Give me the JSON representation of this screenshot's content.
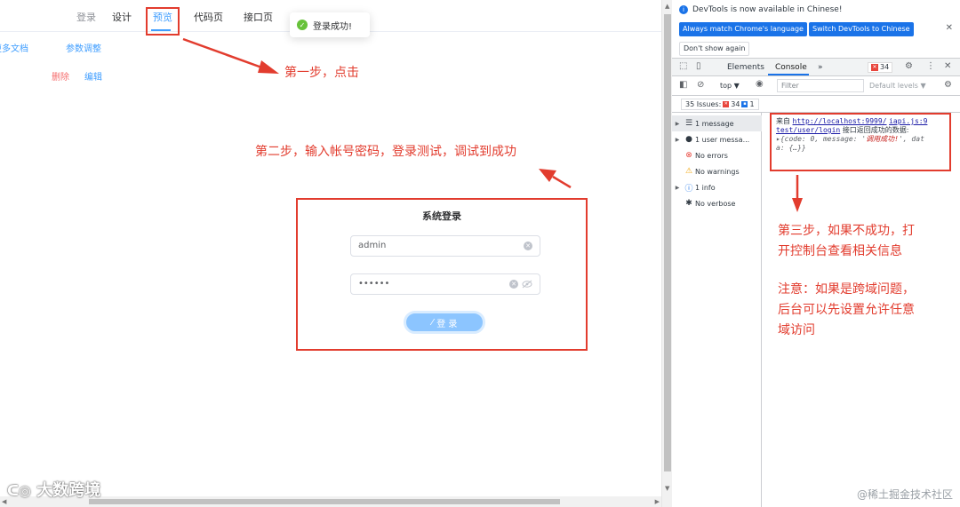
{
  "app": {
    "nav": {
      "login": "登录",
      "design": "设计",
      "preview": "预览",
      "code_page": "代码页",
      "api_page": "接口页"
    },
    "toast": "登录成功!",
    "links": {
      "more_docs": "更多文档",
      "param_adjust": "参数调整",
      "delete": "删除",
      "edit": "编辑"
    },
    "annotations": {
      "step1": "第一步，点击",
      "step2": "第二步，输入帐号密码，登录测试，调试到成功"
    },
    "login_form": {
      "title": "系统登录",
      "username": "admin",
      "password": "••••••",
      "button": "登 录"
    },
    "watermark_left": "大数跨境"
  },
  "devtools": {
    "banner": "DevTools is now available in Chinese!",
    "btn_match": "Always match Chrome's language",
    "btn_switch": "Switch DevTools to Chinese",
    "btn_dont_show": "Don't show again",
    "tabs": {
      "elements": "Elements",
      "console": "Console",
      "more": "»",
      "error_count": "34"
    },
    "filter": {
      "context": "top ▼",
      "placeholder": "Filter",
      "levels": "Default levels ▼"
    },
    "issues": {
      "label": "35 Issues:",
      "errors": "34",
      "info": "1"
    },
    "sidebar": [
      {
        "label": "1 message",
        "icon": "list-icon"
      },
      {
        "label": "1 user messa...",
        "icon": "user-icon"
      },
      {
        "label": "No errors",
        "icon": "error-icon"
      },
      {
        "label": "No warnings",
        "icon": "warning-icon"
      },
      {
        "label": "1 info",
        "icon": "info-icon"
      },
      {
        "label": "No verbose",
        "icon": "bug-icon"
      }
    ],
    "log": {
      "prefix": "来自",
      "url1": "http://localhost:9999/",
      "file": "iapi.js:9",
      "url2": "test/user/login",
      "msg": "接口返回成功的数据:",
      "obj1": "{code: 0, message: '",
      "obj_str": "调用成功!",
      "obj2": "', dat",
      "obj3": "a: {…}}"
    },
    "annotations": {
      "step3_line1": "第三步，如果不成功，打",
      "step3_line2": "开控制台查看相关信息",
      "note_line1": "注意：如果是跨域问题，",
      "note_line2": "后台可以先设置允许任意",
      "note_line3": "域访问"
    },
    "watermark": "@稀土掘金技术社区"
  }
}
